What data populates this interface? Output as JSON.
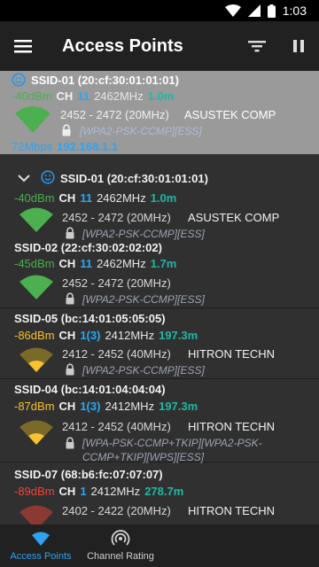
{
  "status_bar": {
    "time": "1:03"
  },
  "app_bar": {
    "title": "Access Points"
  },
  "connected": {
    "ssid": "SSID-01 (20:cf:30:01:01:01)",
    "signal": "-40dBm",
    "ch_label": "CH",
    "channel": "11",
    "freq": "2462MHz",
    "distance": "1.0m",
    "range": "2452 - 2472 (20MHz)",
    "vendor": "ASUSTEK COMP",
    "security": "[WPA2-PSK-CCMP][ESS]",
    "link_speed": "72Mbps",
    "ip": "192.168.1.1"
  },
  "access_points": [
    {
      "ssid": "SSID-01 (20:cf:30:01:01:01)",
      "signal": "-40dBm",
      "ch_label": "CH",
      "channel": "11",
      "freq": "2462MHz",
      "distance": "1.0m",
      "range": "2452 - 2472 (20MHz)",
      "vendor": "ASUSTEK COMP",
      "security": "[WPA2-PSK-CCMP][ESS]"
    },
    {
      "ssid": "SSID-02 (22:cf:30:02:02:02)",
      "signal": "-45dBm",
      "ch_label": "CH",
      "channel": "11",
      "freq": "2462MHz",
      "distance": "1.7m",
      "range": "2452 - 2472 (20MHz)",
      "vendor": "",
      "security": "[WPA2-PSK-CCMP][ESS]"
    },
    {
      "ssid": "SSID-05 (bc:14:01:05:05:05)",
      "signal": "-86dBm",
      "ch_label": "CH",
      "channel": "1(3)",
      "freq": "2412MHz",
      "distance": "197.3m",
      "range": "2412 - 2452 (40MHz)",
      "vendor": "HITRON TECHN",
      "security": "[WPA2-PSK-CCMP][ESS]"
    },
    {
      "ssid": "SSID-04 (bc:14:01:04:04:04)",
      "signal": "-87dBm",
      "ch_label": "CH",
      "channel": "1(3)",
      "freq": "2412MHz",
      "distance": "197.3m",
      "range": "2412 - 2452 (40MHz)",
      "vendor": "HITRON TECHN",
      "security_line1": "[WPA-PSK-CCMP+TKIP][WPA2-PSK-",
      "security_line2": "CCMP+TKIP][WPS][ESS]"
    },
    {
      "ssid": "SSID-07 (68:b6:fc:07:07:07)",
      "signal": "-89dBm",
      "ch_label": "CH",
      "channel": "1",
      "freq": "2412MHz",
      "distance": "278.7m",
      "range": "2402 - 2422 (20MHz)",
      "vendor": "HITRON TECHN"
    }
  ],
  "bottom_nav": {
    "access_points": "Access Points",
    "channel_rating": "Channel Rating"
  },
  "colors": {
    "accent": "#2ea3f2",
    "green": "#4caf50",
    "yellow": "#f9c22e",
    "red": "#f44336",
    "teal": "#1fb8a6"
  }
}
